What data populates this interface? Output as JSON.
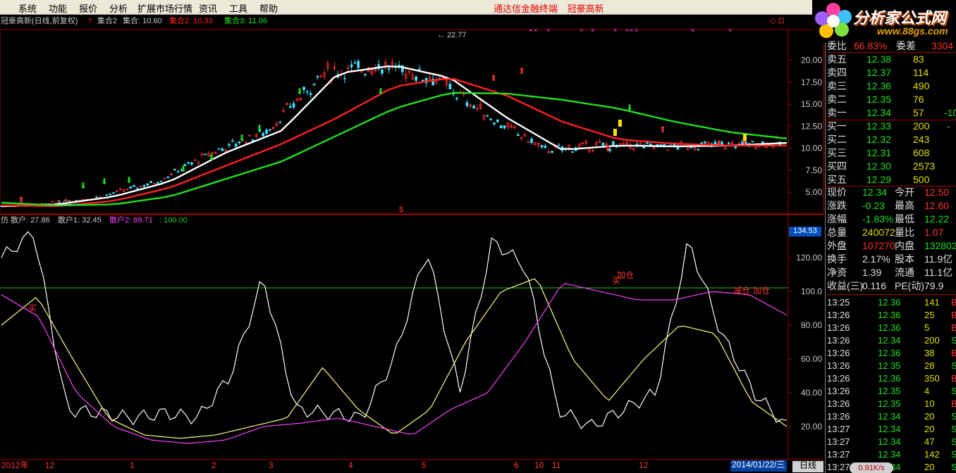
{
  "menu": [
    "系统",
    "功能",
    "报价",
    "分析",
    "扩展市场行情",
    "资讯",
    "工具",
    "帮助"
  ],
  "title_center": [
    "通达信金融终端",
    "冠豪高新"
  ],
  "logo": {
    "text": "分析家公式网",
    "url": "www.88gs.com"
  },
  "main_chart": {
    "header": "冠豪高新(日线,前复权)",
    "indicators": [
      {
        "name": "集合2",
        "value": "10.60"
      },
      {
        "name": "集合2",
        "value": "10.33",
        "color": "#ff2020"
      },
      {
        "name": "集合3",
        "value": "11.06",
        "color": "#20e020"
      }
    ],
    "yticks": [
      "20.00",
      "17.50",
      "15.00",
      "12.50",
      "10.00",
      "7.50",
      "5.00"
    ],
    "high_label": "22.77",
    "low_label": "3.09",
    "marker_s": "$"
  },
  "sub_chart": {
    "header": "仿 散户:",
    "v1": "27.86",
    "l2": "散户1:",
    "v2": "32.45",
    "l3": "散户2:",
    "v3": "88.71",
    "v4": ": 100.00",
    "yticks": [
      "120.00",
      "100.0",
      "80.00",
      "60.00",
      "40.00",
      "20.00"
    ],
    "current": "134.53",
    "labels": [
      "买",
      "加仓",
      "买",
      "减仓",
      "加仓"
    ]
  },
  "chart_data": [
    {
      "type": "line",
      "title": "冠豪高新(日线,前复权)",
      "ylim": [
        3,
        23
      ],
      "x": [
        "2012-11",
        "2012-12",
        "2013-01",
        "2013-02",
        "2013-03",
        "2013-04",
        "2013-05",
        "2013-06",
        "2013-07",
        "2013-08",
        "2013-09",
        "2013-10",
        "2013-11",
        "2013-12",
        "2014-01"
      ],
      "series": [
        {
          "name": "集合2",
          "color": "#ffffff",
          "values": [
            3.4,
            3.6,
            4.5,
            6.2,
            9.5,
            12.0,
            18.5,
            19.4,
            18.0,
            13.5,
            9.8,
            10.3,
            10.2,
            10.3,
            10.6
          ]
        },
        {
          "name": "集合2",
          "color": "#ff2020",
          "values": [
            3.5,
            3.4,
            4.0,
            5.5,
            8.0,
            10.5,
            13.5,
            17.0,
            18.0,
            16.0,
            13.0,
            11.0,
            10.5,
            10.3,
            10.3
          ]
        },
        {
          "name": "集合3",
          "color": "#20e020",
          "values": [
            3.8,
            3.5,
            3.6,
            4.5,
            6.5,
            8.5,
            11.5,
            14.5,
            16.3,
            16.2,
            15.5,
            14.5,
            13.0,
            11.8,
            11.1
          ]
        }
      ]
    },
    {
      "type": "line",
      "title": "散户",
      "ylim": [
        10,
        135
      ],
      "series": [
        {
          "name": "散户",
          "color": "#ffffff",
          "values": [
            120,
            135,
            30,
            28,
            25,
            28,
            25,
            50,
            108,
            30,
            28,
            25,
            60,
            125,
            40,
            130,
            115,
            30,
            20,
            30,
            40,
            130,
            75,
            40,
            20
          ]
        },
        {
          "name": "散户1",
          "color": "#ffff80",
          "values": [
            80,
            97,
            60,
            25,
            15,
            13,
            15,
            20,
            25,
            55,
            30,
            15,
            30,
            70,
            100,
            108,
            60,
            35,
            60,
            80,
            75,
            35,
            20
          ]
        },
        {
          "name": "散户2",
          "color": "#ff40ff",
          "values": [
            98,
            85,
            40,
            20,
            12,
            10,
            12,
            20,
            22,
            25,
            20,
            15,
            30,
            40,
            70,
            105,
            100,
            95,
            95,
            100,
            98,
            86
          ]
        }
      ]
    }
  ],
  "xaxis": [
    "2012年",
    "12",
    "1",
    "2",
    "3",
    "4",
    "5",
    "6",
    "10",
    "11",
    "12",
    "2014/01/22/三",
    "日线"
  ],
  "quote": {
    "top_row": {
      "a": "委比",
      "av": "66.83%",
      "b": "委差",
      "bv": "3304"
    },
    "sell": [
      {
        "l": "卖五",
        "p": "12.38",
        "v": "83"
      },
      {
        "l": "卖四",
        "p": "12.37",
        "v": "114"
      },
      {
        "l": "卖三",
        "p": "12.36",
        "v": "490"
      },
      {
        "l": "卖二",
        "p": "12.35",
        "v": "76"
      },
      {
        "l": "卖一",
        "p": "12.34",
        "v": "57",
        "x": "-10"
      }
    ],
    "buy": [
      {
        "l": "买一",
        "p": "12.33",
        "v": "200",
        "x": "-"
      },
      {
        "l": "买二",
        "p": "12.32",
        "v": "243"
      },
      {
        "l": "买三",
        "p": "12.31",
        "v": "608"
      },
      {
        "l": "买四",
        "p": "12.30",
        "v": "2573"
      },
      {
        "l": "买五",
        "p": "12.29",
        "v": "500"
      }
    ],
    "stats": [
      {
        "l1": "现价",
        "v1": "12.34",
        "c1": "#20e020",
        "l2": "今开",
        "v2": "12.50",
        "c2": "#ff3030"
      },
      {
        "l1": "涨跌",
        "v1": "-0.23",
        "c1": "#20e020",
        "l2": "最高",
        "v2": "12.60",
        "c2": "#ff3030"
      },
      {
        "l1": "涨幅",
        "v1": "-1.83%",
        "c1": "#20e020",
        "l2": "最低",
        "v2": "12.22",
        "c2": "#20e020"
      },
      {
        "l1": "总量",
        "v1": "240072",
        "c1": "#e0e000",
        "l2": "量比",
        "v2": "1.07",
        "c2": "#ff3030"
      },
      {
        "l1": "外盘",
        "v1": "107270",
        "c1": "#ff3030",
        "l2": "内盘",
        "v2": "132802",
        "c2": "#20e020"
      },
      {
        "l1": "换手",
        "v1": "2.17%",
        "c1": "#e0e0e0",
        "l2": "股本",
        "v2": "11.9亿",
        "c2": "#e0e0e0"
      },
      {
        "l1": "净资",
        "v1": "1.39",
        "c1": "#e0e0e0",
        "l2": "流通",
        "v2": "11.1亿",
        "c2": "#e0e0e0"
      },
      {
        "l1": "收益(三)",
        "v1": "0.116",
        "c1": "#e0e0e0",
        "l2": "PE(动)",
        "v2": "79.9",
        "c2": "#e0e0e0"
      }
    ],
    "ticks": [
      {
        "t": "13:25",
        "p": "12.36",
        "v": "141",
        "s": "B"
      },
      {
        "t": "13:26",
        "p": "12.36",
        "v": "25",
        "s": "B"
      },
      {
        "t": "13:26",
        "p": "12.36",
        "v": "5",
        "s": "B"
      },
      {
        "t": "13:26",
        "p": "12.34",
        "v": "200",
        "s": "S"
      },
      {
        "t": "13:26",
        "p": "12.36",
        "v": "38",
        "s": "B"
      },
      {
        "t": "13:26",
        "p": "12.35",
        "v": "28",
        "s": "S"
      },
      {
        "t": "13:26",
        "p": "12.36",
        "v": "350",
        "s": "B"
      },
      {
        "t": "13:26",
        "p": "12.35",
        "v": "4",
        "s": "S"
      },
      {
        "t": "13:26",
        "p": "12.35",
        "v": "10",
        "s": "B"
      },
      {
        "t": "13:26",
        "p": "12.34",
        "v": "20",
        "s": "S"
      },
      {
        "t": "13:27",
        "p": "12.34",
        "v": "20",
        "s": "S"
      },
      {
        "t": "13:27",
        "p": "12.34",
        "v": "47",
        "s": "S"
      },
      {
        "t": "13:27",
        "p": "12.34",
        "v": "142",
        "s": "S"
      },
      {
        "t": "13:27",
        "p": "12.34",
        "v": "20",
        "s": "S"
      }
    ],
    "status": "0.91K/s"
  }
}
